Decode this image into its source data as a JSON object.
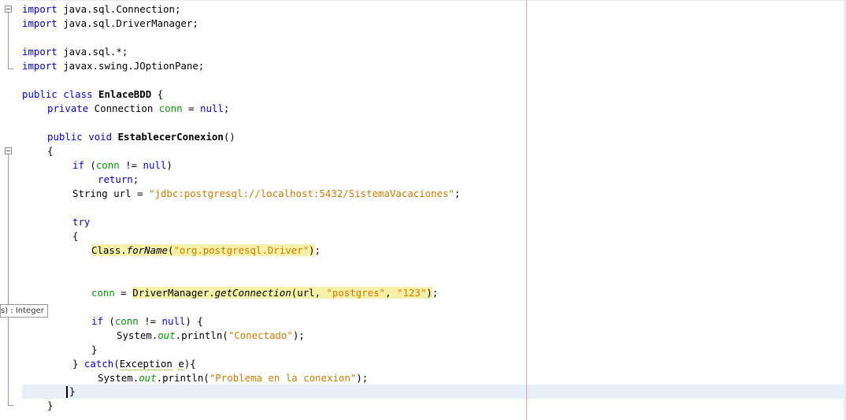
{
  "editor": {
    "tooltip": "s) : Integer",
    "lines": {
      "l1": {
        "kw": "import",
        "rest": " java.sql.Connection;"
      },
      "l2": {
        "kw": "import",
        "rest": " java.sql.DriverManager;"
      },
      "l4": {
        "kw": "import",
        "rest": " java.sql.*;"
      },
      "l5": {
        "kw": "import",
        "rest": " javax.swing.JOptionPane;"
      },
      "l7": {
        "kw1": "public",
        "kw2": "class",
        "name": "EnlaceBDD",
        "rest": " {"
      },
      "l8": {
        "kw": "private",
        "type": " Connection ",
        "field": "conn",
        "eq": " = ",
        "nullkw": "null",
        "end": ";"
      },
      "l10": {
        "kw1": "public",
        "kw2": "void",
        "name": "EstablecerConexion",
        "rest": "()"
      },
      "l11": {
        "text": "{"
      },
      "l12": {
        "kw": "if",
        "open": " (",
        "field": "conn",
        "op": " != ",
        "nullkw": "null",
        "close": ")"
      },
      "l13": {
        "kw": "return",
        "end": ";"
      },
      "l14": {
        "pre": "String url = ",
        "str": "\"jdbc:postgresql://localhost:5432/SistemaVacaciones\"",
        "end": ";"
      },
      "l16": {
        "kw": "try"
      },
      "l17": {
        "text": "{"
      },
      "l18": {
        "cls": "Class.",
        "method": "forName",
        "open": "(",
        "str": "\"org.postgresql.Driver\"",
        "close": ")",
        "end": ";"
      },
      "l21": {
        "field": "conn",
        "eq": " = ",
        "cls": "DriverManager.",
        "method": "getConnection",
        "args1": "(url, ",
        "s1": "\"postgres\"",
        "comma": ", ",
        "s2": "\"123\"",
        "close": ")",
        "end": ";"
      },
      "l23": {
        "kw": "if",
        "open": " (",
        "field": "conn",
        "op": " != ",
        "nullkw": "null",
        "close": ") {"
      },
      "l24": {
        "pre": "System.",
        "out": "out",
        "call": ".println(",
        "str": "\"Conectado\"",
        "end": ");"
      },
      "l25": {
        "text": "}"
      },
      "l26": {
        "pre": "} ",
        "kw": "catch",
        "open": "(",
        "exc": "Exception",
        "sp": " ",
        "var": "e",
        "close": "){"
      },
      "l27": {
        "pre": "System.",
        "out": "out",
        "call": ".println(",
        "str": "\"Problema en la conexion\"",
        "end": ");"
      },
      "l28": {
        "text": "}"
      },
      "l29": {
        "text": "}"
      }
    }
  }
}
